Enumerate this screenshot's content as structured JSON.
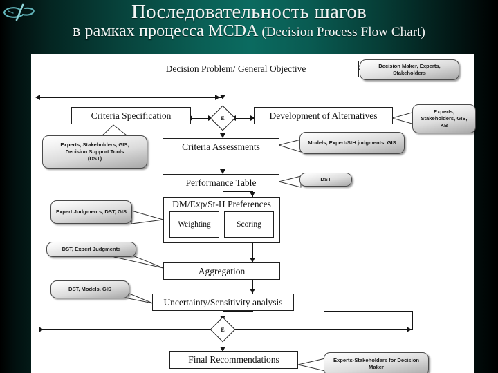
{
  "slide": {
    "title_line1": "Последовательность шагов",
    "title_line2_ru": "в рамках процесса MCDA ",
    "title_line2_en": "(Decision Process Flow Chart)",
    "logo_name": "institute-logo",
    "background_accent": "#0b6b60",
    "canvas_color": "#ffffff"
  },
  "diagram": {
    "type": "flowchart",
    "nodes": [
      {
        "id": "decision_problem",
        "label": "Decision Problem/ General Objective"
      },
      {
        "id": "criteria_spec",
        "label": "Criteria Specification"
      },
      {
        "id": "dev_alternatives",
        "label": "Development of Alternatives"
      },
      {
        "id": "criteria_assess",
        "label": "Criteria Assessments"
      },
      {
        "id": "performance_table",
        "label": "Performance Table"
      },
      {
        "id": "preferences",
        "label": "DM/Exp/St-H Preferences"
      },
      {
        "id": "weighting",
        "label": "Weighting"
      },
      {
        "id": "scoring",
        "label": "Scoring"
      },
      {
        "id": "aggregation",
        "label": "Aggregation"
      },
      {
        "id": "uncertainty",
        "label": "Uncertainty/Sensitivity  analysis"
      },
      {
        "id": "final_rec",
        "label": "Final Recommendations"
      }
    ],
    "junctions": [
      {
        "id": "junction_top",
        "label": "E"
      },
      {
        "id": "junction_bottom",
        "label": "E"
      }
    ],
    "callouts": [
      {
        "id": "callout_dm_experts",
        "text": "Decision Maker, Experts, Stakeholders"
      },
      {
        "id": "callout_experts_gis_kb",
        "text": "Experts, Stakeholders, GIS, KB"
      },
      {
        "id": "callout_models",
        "text": "Models, Expert-StH judgments, GIS"
      },
      {
        "id": "callout_dst",
        "text": "DST"
      },
      {
        "id": "callout_experts_dst",
        "line1": "Experts, Stakeholders, GIS,",
        "line2": "Decision Support Tools",
        "line3": "(DST)"
      },
      {
        "id": "callout_expert_judg",
        "text": "Expert Judgments, DST, GIS"
      },
      {
        "id": "callout_dst_expert",
        "text": "DST, Expert Judgments"
      },
      {
        "id": "callout_dst_models_gis",
        "text": "DST, Models, GIS"
      },
      {
        "id": "callout_experts_sth",
        "text": "Experts-Stakeholders for Decision Maker"
      }
    ]
  }
}
